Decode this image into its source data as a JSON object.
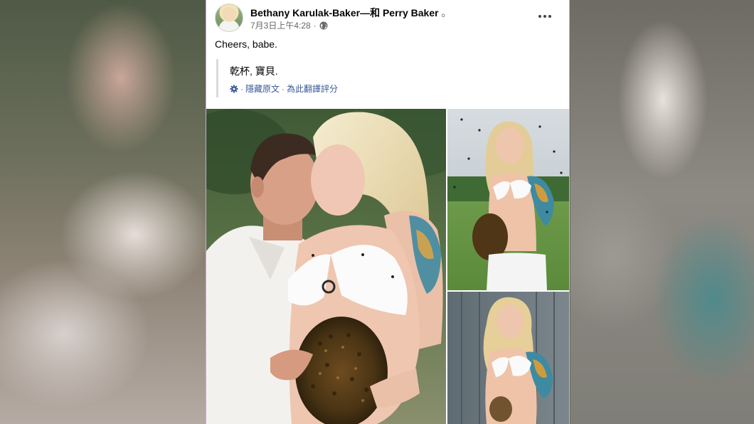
{
  "post": {
    "author": "Bethany Karulak-Baker",
    "with_connector": "—和",
    "tagged": "Perry Baker",
    "trailing_dot": "。",
    "timestamp": "7月3日上午4:28",
    "meta_sep": "·",
    "audience_icon": "globe-icon",
    "text": "Cheers, babe.",
    "translation": {
      "text": "乾杯, 寶貝.",
      "icon": "gear-icon",
      "hide_original": "隱藏原文",
      "rate_translation": "為此翻譯評分",
      "separator": "·"
    },
    "menu_icon": "more-options-icon"
  },
  "photos": [
    {
      "name": "photo-couple-kiss"
    },
    {
      "name": "photo-woman-field"
    },
    {
      "name": "photo-woman-barn"
    }
  ],
  "colors": {
    "link": "#385898",
    "meta": "#65676b",
    "card_border": "#c9a9d6"
  }
}
